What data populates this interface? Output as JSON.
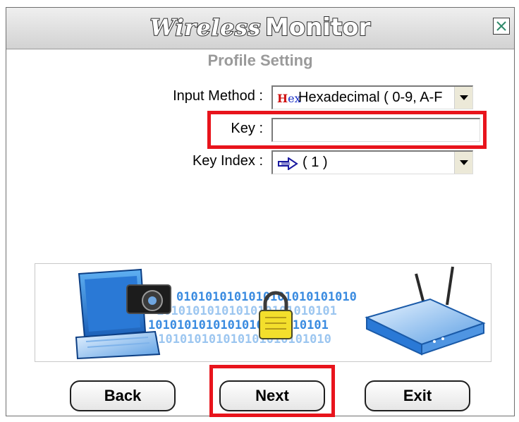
{
  "window": {
    "title_part1": "Wireless",
    "title_part2": "Monitor",
    "subtitle": "Profile Setting",
    "close_symbol": "close-icon"
  },
  "form": {
    "input_method": {
      "label": "Input Method :",
      "value": "Hexadecimal ( 0-9, A-F",
      "icon_text_h": "H",
      "icon_text_ex": "ex"
    },
    "key": {
      "label": "Key :",
      "value": ""
    },
    "key_index": {
      "label": "Key Index :",
      "value": "( 1 )",
      "icon": "arrow-icon"
    }
  },
  "banner": {
    "binary_rows": [
      "0101010101010101010101010",
      "1010101010101010101010101",
      "1010101010101010101010101",
      "0101010101010101010101010"
    ],
    "icons": [
      "laptop-icon",
      "camera-icon",
      "padlock-icon",
      "router-icon"
    ]
  },
  "buttons": {
    "back": "Back",
    "next": "Next",
    "exit": "Exit"
  },
  "colors": {
    "highlight": "#e8141c",
    "subtitle": "#9a9a9a",
    "binary": "#3a8be0"
  }
}
